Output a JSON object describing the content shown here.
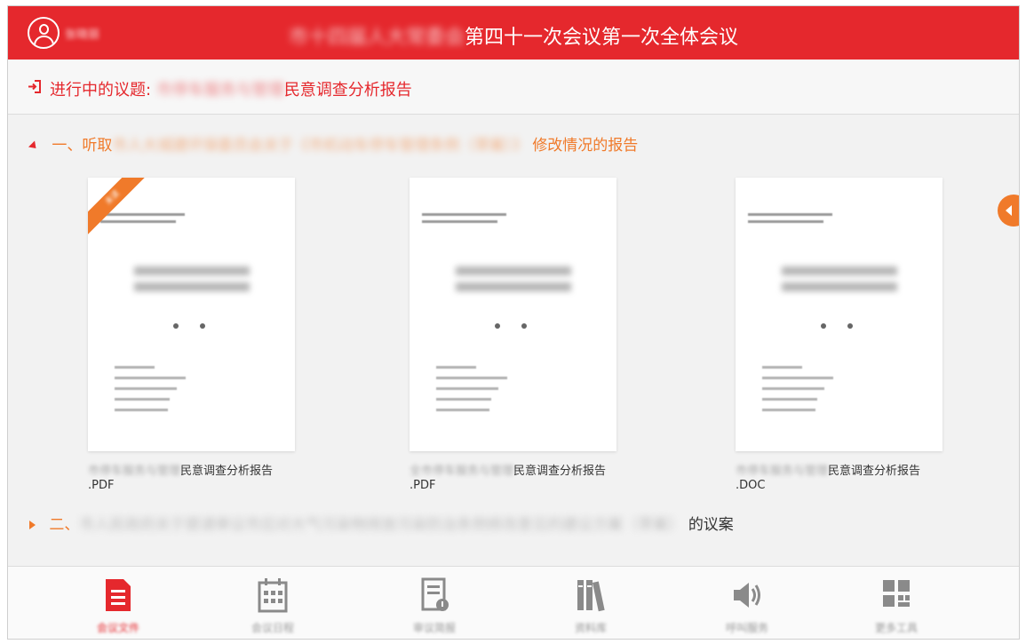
{
  "header": {
    "user_name": "张晓丽",
    "title_blurred": "市十四届人大常委会",
    "title_visible": "第四十一次会议第一次全体会议"
  },
  "agenda": {
    "label": "进行中的议题:",
    "topic_blurred": "市停车服务与管理",
    "topic_visible": "民意调查分析报告"
  },
  "sections": [
    {
      "number": "一、听取",
      "blurred": "市人大城建环保委员会关于《市机动车停车管理条例（草案）》",
      "visible": "修改情况的报告",
      "expanded": true
    },
    {
      "number": "二、",
      "blurred": "市人民政府关于提请审议市应对大气污染物排放污染防治条例修改意见的建议方案（草案）",
      "visible": "的议案",
      "expanded": false
    }
  ],
  "documents": [
    {
      "name_blurred": "市停车服务与管理",
      "name_visible": "民意调查分析报告",
      "ext": ".PDF",
      "badge": "未读"
    },
    {
      "name_blurred": "全市停车服务与管理",
      "name_visible": "民意调查分析报告",
      "ext": ".PDF",
      "badge": ""
    },
    {
      "name_blurred": "市停车服务与管理",
      "name_visible": "民意调查分析报告",
      "ext": ".DOC",
      "badge": ""
    }
  ],
  "bottom_nav": [
    {
      "label": "会议文件",
      "icon": "document-icon",
      "active": true
    },
    {
      "label": "会议日程",
      "icon": "calendar-icon",
      "active": false
    },
    {
      "label": "审议简报",
      "icon": "briefing-icon",
      "active": false
    },
    {
      "label": "资料库",
      "icon": "library-icon",
      "active": false
    },
    {
      "label": "呼叫服务",
      "icon": "call-service-icon",
      "active": false
    },
    {
      "label": "更多工具",
      "icon": "more-tools-icon",
      "active": false
    }
  ],
  "colors": {
    "header_red": "#e5282d",
    "accent_orange": "#f07a2a",
    "inactive_gray": "#999999"
  }
}
